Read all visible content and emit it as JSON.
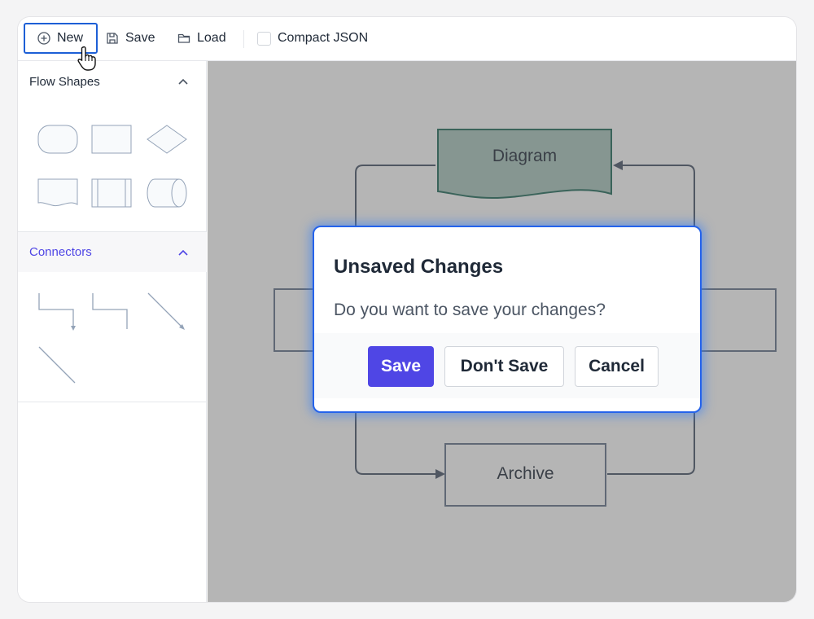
{
  "toolbar": {
    "new_label": "New",
    "save_label": "Save",
    "load_label": "Load",
    "compact_json_label": "Compact JSON",
    "compact_json_checked": false
  },
  "sidebar": {
    "shapes_title": "Flow Shapes",
    "connectors_title": "Connectors",
    "shapes": [
      "terminator",
      "process",
      "decision",
      "document",
      "predefined-process",
      "cylinder"
    ],
    "connectors": [
      "elbow-arrow",
      "elbow",
      "straight-arrow",
      "straight-line"
    ]
  },
  "canvas": {
    "nodes": {
      "diagram": "Diagram",
      "archive": "Archive"
    }
  },
  "dialog": {
    "title": "Unsaved Changes",
    "message": "Do you want to save your changes?",
    "save_label": "Save",
    "dont_save_label": "Don't Save",
    "cancel_label": "Cancel"
  },
  "colors": {
    "accent": "#4f46e5",
    "focus_ring": "#2563eb",
    "diagram_fill": "#a9c7bd",
    "diagram_stroke": "#1f6b5a"
  }
}
